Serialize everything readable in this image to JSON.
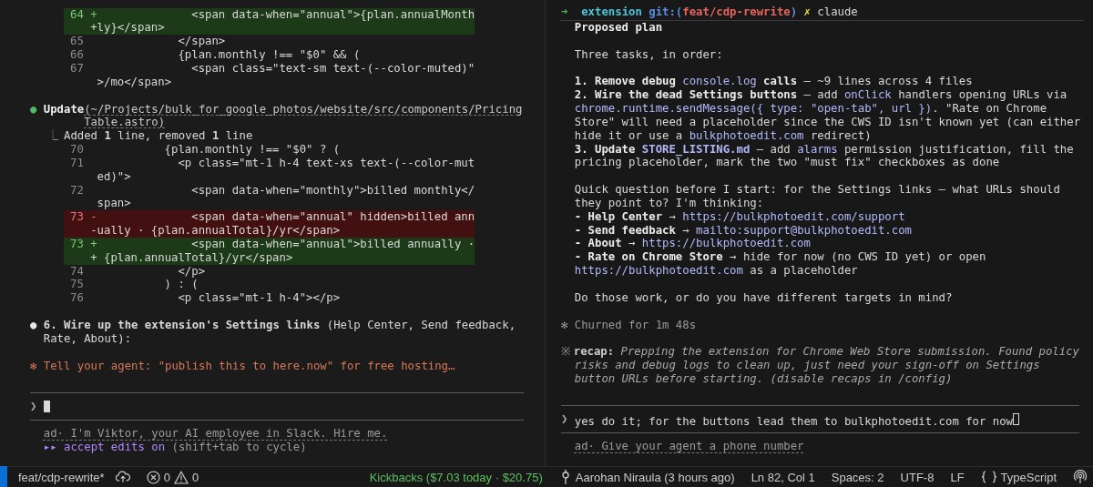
{
  "left_pane": {
    "diff_before": [
      {
        "number": "64",
        "sign": "+",
        "kind": "added",
        "text": "              <span data-when=\"annual\">{plan.annualMonth",
        "wrap": "+ly}</span>"
      },
      {
        "number": "65",
        "kind": "context",
        "text": "            </span>"
      },
      {
        "number": "66",
        "kind": "context",
        "text": "            {plan.monthly !== \"$0\" && ("
      },
      {
        "number": "67",
        "kind": "context",
        "text": "              <span class=\"text-sm text-(--color-muted)\"",
        "wrap": " >/mo</span>"
      }
    ],
    "tool_call": {
      "bullet": "●",
      "name": "Update",
      "path": "(~/Projects/bulk_for_google_photos/website/src/components/Pricing",
      "path_wrap": "Table.astro)"
    },
    "tool_result": {
      "connector": "⎿",
      "text": "Added **1** line, removed **1** line"
    },
    "diff_after": [
      {
        "number": "70",
        "kind": "context",
        "text": "          {plan.monthly !== \"$0\" ? ("
      },
      {
        "number": "71",
        "kind": "context",
        "text": "            <p class=\"mt-1 h-4 text-xs text-(--color-mut",
        "wrap": " ed)\">"
      },
      {
        "number": "72",
        "kind": "context",
        "text": "              <span data-when=\"monthly\">billed monthly</",
        "wrap": " span>"
      },
      {
        "number": "73",
        "sign": "-",
        "kind": "removed",
        "text": "              <span data-when=\"annual\" hidden>billed ann",
        "wrap": "-ually · {plan.annualTotal}/yr</span>"
      },
      {
        "number": "73",
        "sign": "+",
        "kind": "added",
        "text": "              <span data-when=\"annual\">billed annually ·",
        "wrap": "+ {plan.annualTotal}/yr</span>"
      },
      {
        "number": "74",
        "kind": "context",
        "text": "            </p>"
      },
      {
        "number": "75",
        "kind": "context",
        "text": "          ) : ("
      },
      {
        "number": "76",
        "kind": "context",
        "text": "            <p class=\"mt-1 h-4\"></p>"
      }
    ],
    "task": {
      "bullet": "●",
      "lines": [
        "**6. Wire up the extension's Settings links** (Help Center, Send feedback,",
        "Rate, About):"
      ]
    },
    "tip": {
      "icon": "✻",
      "text": "Tell your agent: \"publish this to here.now\" for free hosting…"
    },
    "prompt": {
      "symbol": "❯",
      "focused": true
    },
    "ad": "ad· I'm Viktor, your AI employee in Slack. Hire me.",
    "mode": {
      "icon": "▸▸",
      "label": "accept edits on",
      "hint": "(shift+tab to cycle)"
    }
  },
  "right_pane": {
    "header": [
      {
        "kind": "arrow",
        "text": "➜"
      },
      {
        "kind": "directory",
        "text": "  extension"
      },
      {
        "kind": "git",
        "text": " git:("
      },
      {
        "kind": "branch",
        "text": "feat/cdp-rewrite"
      },
      {
        "kind": "git",
        "text": ")"
      },
      {
        "kind": "dirty",
        "text": " ✗"
      },
      {
        "kind": "text",
        "text": " claude"
      }
    ],
    "paragraphs": [
      {
        "lines": [
          [
            {
              "kind": "bold",
              "text": "Proposed plan"
            }
          ]
        ]
      },
      {
        "lines": [
          [
            {
              "kind": "text",
              "text": "Three tasks, in order:"
            }
          ]
        ]
      },
      {
        "lines": [
          [
            {
              "kind": "bold",
              "text": "1. Remove debug "
            },
            {
              "kind": "code",
              "text": "console.log"
            },
            {
              "kind": "bold",
              "text": " calls"
            },
            {
              "kind": "text",
              "text": " — ~9 lines across 4 files"
            }
          ],
          [
            {
              "kind": "bold",
              "text": "2. Wire the dead Settings buttons"
            },
            {
              "kind": "text",
              "text": " — add "
            },
            {
              "kind": "code",
              "text": "onClick"
            },
            {
              "kind": "text",
              "text": " handlers opening URLs via"
            }
          ],
          [
            {
              "kind": "code",
              "text": "chrome.runtime.sendMessage({ type: \"open-tab\", url })"
            },
            {
              "kind": "text",
              "text": ". \"Rate on Chrome"
            }
          ],
          [
            {
              "kind": "text",
              "text": "Store\" will need a placeholder since the CWS ID isn't known yet (can either"
            }
          ],
          [
            {
              "kind": "text",
              "text": "hide it or use a "
            },
            {
              "kind": "code",
              "text": "bulkphotoedit.com"
            },
            {
              "kind": "text",
              "text": " redirect)"
            }
          ],
          [
            {
              "kind": "bold",
              "text": "3. Update "
            },
            {
              "kind": "code_bold",
              "text": "STORE_LISTING.md"
            },
            {
              "kind": "text",
              "text": " — add "
            },
            {
              "kind": "code",
              "text": "alarms"
            },
            {
              "kind": "text",
              "text": " permission justification, fill the"
            }
          ],
          [
            {
              "kind": "text",
              "text": "pricing placeholder, mark the two \"must fix\" checkboxes as done"
            }
          ]
        ]
      },
      {
        "lines": [
          [
            {
              "kind": "text",
              "text": "Quick question before I start: for the Settings links — what URLs should"
            }
          ],
          [
            {
              "kind": "text",
              "text": "they point to? I'm thinking:"
            }
          ],
          [
            {
              "kind": "bold",
              "text": "- Help Center"
            },
            {
              "kind": "text",
              "text": " → "
            },
            {
              "kind": "code",
              "text": "https://bulkphotoedit.com/support"
            }
          ],
          [
            {
              "kind": "bold",
              "text": "- Send feedback"
            },
            {
              "kind": "text",
              "text": " → "
            },
            {
              "kind": "code",
              "text": "mailto:support@bulkphotoedit.com"
            }
          ],
          [
            {
              "kind": "bold",
              "text": "- About"
            },
            {
              "kind": "text",
              "text": " → "
            },
            {
              "kind": "code",
              "text": "https://bulkphotoedit.com"
            }
          ],
          [
            {
              "kind": "bold",
              "text": "- Rate on Chrome Store"
            },
            {
              "kind": "text",
              "text": " → hide for now (no CWS ID yet) or open"
            }
          ],
          [
            {
              "kind": "code",
              "text": "https://bulkphotoedit.com"
            },
            {
              "kind": "text",
              "text": " as a placeholder"
            }
          ]
        ]
      },
      {
        "lines": [
          [
            {
              "kind": "text",
              "text": "Do those work, or do you have different targets in mind?"
            }
          ]
        ]
      }
    ],
    "status": {
      "icon": "✻",
      "text": "Churned for 1m 48s"
    },
    "recap": {
      "icon": "※",
      "label": "recap:",
      "lines": [
        " Prepping the extension for Chrome Web Store submission. Found policy",
        "risks and debug logs to clean up, just need your sign-off on Settings",
        "button URLs before starting. (disable recaps in /config)"
      ]
    },
    "prompt": {
      "symbol": "❯",
      "value": "yes do it; for the buttons lead them to bulkphotoedit.com for now",
      "focused": false
    },
    "ad": "ad· Give your agent a phone number"
  },
  "status_bar": {
    "branch": "feat/cdp-rewrite*",
    "errors": "0",
    "warnings": "0",
    "kickbacks": "Kickbacks ($7.03 today · $20.75)",
    "blame": "Aarohan Niraula (3 hours ago)",
    "position": "Ln 82, Col 1",
    "indentation": "Spaces: 2",
    "encoding": "UTF-8",
    "line_ending": "LF",
    "language": "TypeScript"
  }
}
